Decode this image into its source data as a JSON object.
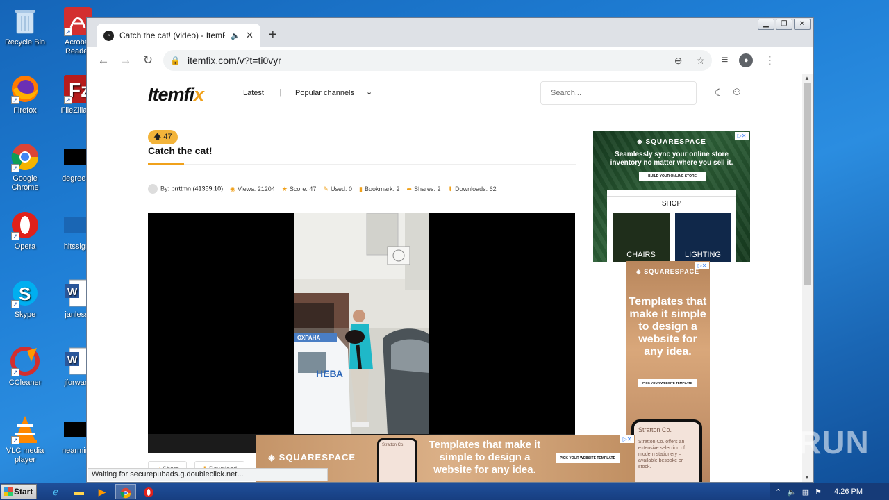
{
  "desktop": {
    "icons": [
      {
        "label": "Recycle Bin"
      },
      {
        "label": "Acrobat Reader"
      },
      {
        "label": "Firefox"
      },
      {
        "label": "FileZilla C"
      },
      {
        "label": "Google Chrome"
      },
      {
        "label": "degreeac"
      },
      {
        "label": "Opera"
      },
      {
        "label": "hitssign."
      },
      {
        "label": "Skype"
      },
      {
        "label": "janless."
      },
      {
        "label": "CCleaner"
      },
      {
        "label": "jforward"
      },
      {
        "label": "VLC media player"
      },
      {
        "label": "nearminu"
      }
    ]
  },
  "browser": {
    "tab_title": "Catch the cat! (video) - ItemFix",
    "url": "itemfix.com/v?t=ti0vyr",
    "status_text": "Waiting for securepubads.g.doubleclick.net..."
  },
  "site": {
    "logo_text": "Itemfi",
    "logo_accent": "x",
    "nav_latest": "Latest",
    "nav_popular": "Popular channels",
    "search_placeholder": "Search..."
  },
  "video": {
    "score_badge": "47",
    "title": "Catch the cat!",
    "meta": {
      "by_label": "By:",
      "author": "brrttmn (41359.10)",
      "views": "Views: 21204",
      "score": "Score: 47",
      "used": "Used: 0",
      "bookmark": "Bookmark: 2",
      "shares": "Shares: 2",
      "downloads": "Downloads: 62"
    },
    "frame_text": {
      "sign": "ОХРАНА",
      "car_text": "НЕВА"
    },
    "share_button": "Share",
    "download_button": "Download"
  },
  "ads": {
    "ad1": {
      "brand": "SQUARESPACE",
      "headline": "Seamlessly sync your online store inventory no matter where you sell it.",
      "cta": "BUILD YOUR ONLINE STORE",
      "shop_title": "SHOP",
      "left_tile": "CHAIRS",
      "right_tile": "LIGHTING"
    },
    "ad2": {
      "brand": "SQUARESPACE",
      "headline": "Templates that make it simple to design a website for any idea.",
      "cta": "PICK YOUR WEBSITE TEMPLATE",
      "phone_brand": "Stratton Co.",
      "phone_text": "Stratton Co. offers an extensive selection of modern stationery – available bespoke or stock."
    },
    "ad3": {
      "brand": "SQUARESPACE",
      "headline": "Templates that make it simple to design a website for any idea.",
      "cta": "PICK YOUR WEBSITE TEMPLATE",
      "phone_brand": "Stratton Co."
    }
  },
  "taskbar": {
    "start_label": "Start",
    "clock": "4:26 PM"
  },
  "watermark": "ANY RUN"
}
